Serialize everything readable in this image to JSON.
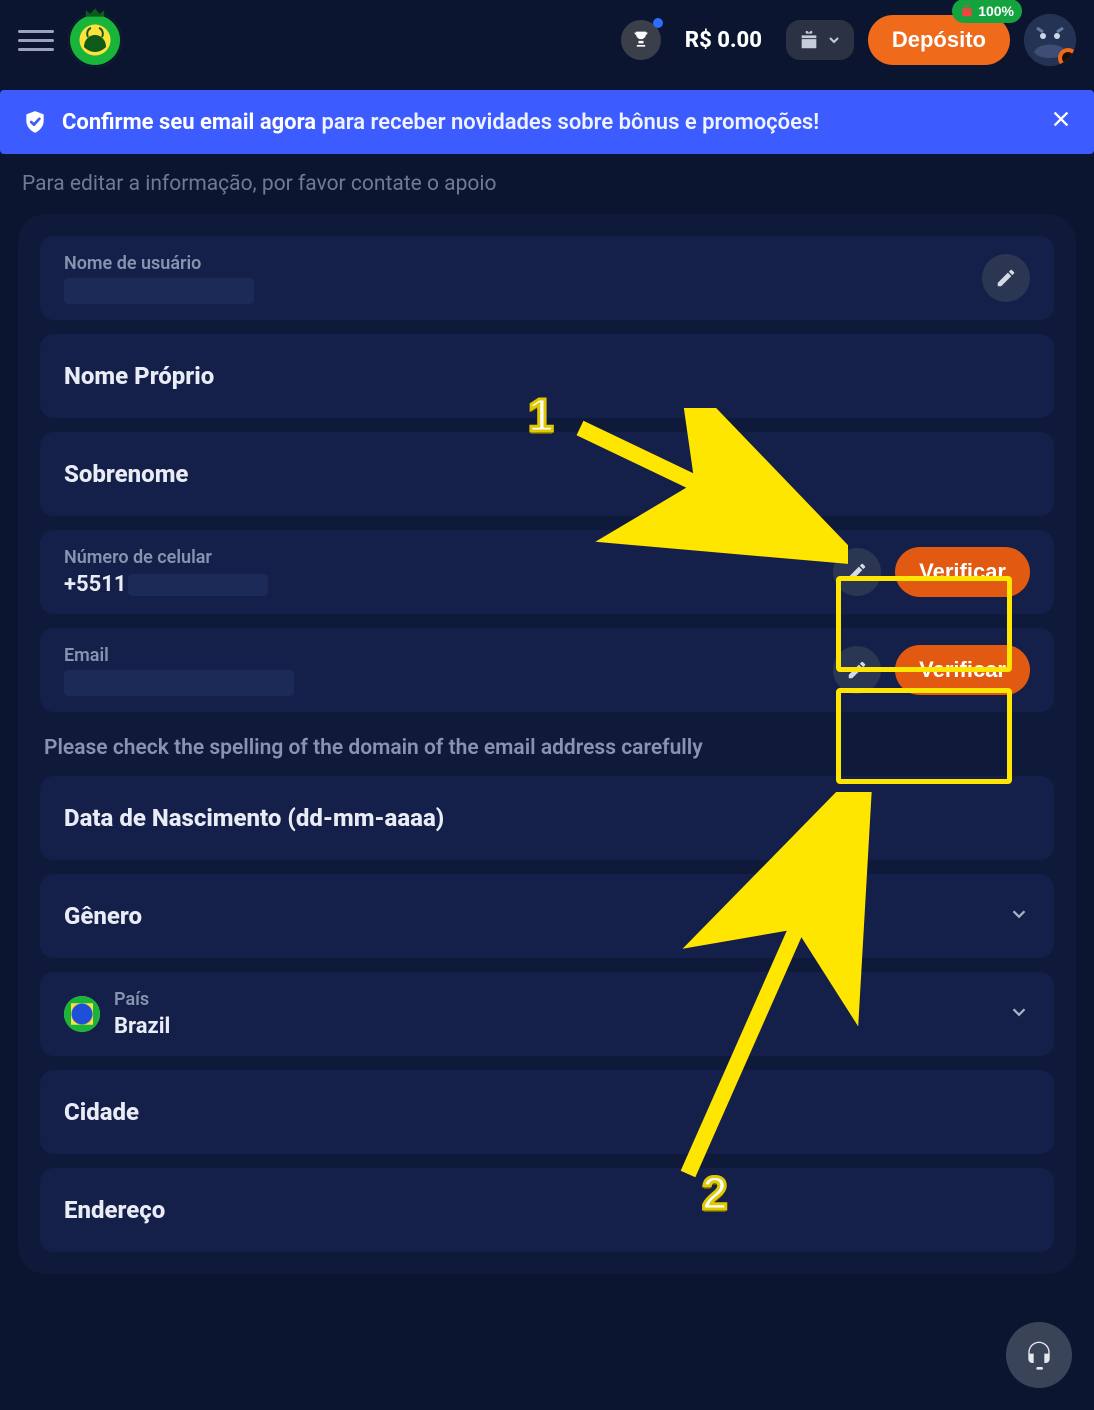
{
  "header": {
    "balance_text": "R$ 0.00",
    "deposit_label": "Depósito",
    "deposit_bonus_badge": "100%"
  },
  "banner": {
    "strong": "Confirme seu email agora",
    "rest": " para receber novidades sobre bônus e promoções!"
  },
  "subtitle": "Para editar a informação, por favor contate o apoio",
  "form": {
    "username_label": "Nome de usuário",
    "first_name_label": "Nome Próprio",
    "last_name_label": "Sobrenome",
    "phone_label": "Número de celular",
    "phone_value_prefix": "+5511",
    "email_label": "Email",
    "verify_label": "Verificar",
    "email_domain_hint": "Please check the spelling of the domain of the email address carefully",
    "dob_label": "Data de Nascimento (dd-mm-aaaa)",
    "gender_label": "Gênero",
    "country_label": "País",
    "country_value": "Brazil",
    "city_label": "Cidade",
    "address_label": "Endereço"
  },
  "annotations": {
    "step1": "1",
    "step2": "2"
  }
}
